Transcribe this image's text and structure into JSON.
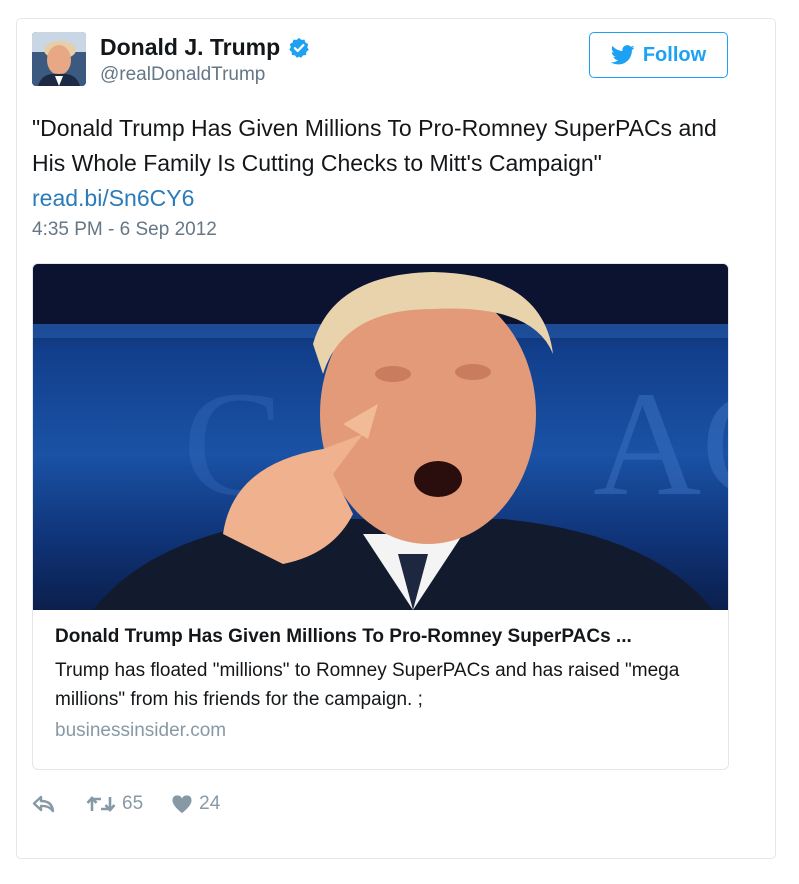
{
  "author": {
    "name": "Donald J. Trump",
    "handle": "@realDonaldTrump",
    "verified_icon": "verified-badge-icon",
    "avatar": "profile-photo"
  },
  "follow_button": {
    "label": "Follow",
    "icon": "twitter-bird-icon",
    "color": "#1da1f2"
  },
  "tweet": {
    "text": "\"Donald Trump Has Given Millions To Pro-Romney SuperPACs and His Whole Family Is Cutting Checks to Mitt's Campaign\"",
    "link": "read.bi/Sn6CY6",
    "timestamp": "4:35 PM - 6 Sep 2012"
  },
  "card": {
    "image": "photo-man-pointing",
    "title": "Donald Trump Has Given Millions To Pro-Romney SuperPACs ...",
    "description": "Trump has floated \"millions\" to Romney SuperPACs and has raised \"mega millions\" from his friends for the campaign. ;",
    "domain": "businessinsider.com"
  },
  "actions": {
    "reply": {
      "icon": "reply-icon"
    },
    "retweet": {
      "icon": "retweet-icon",
      "count": "65"
    },
    "like": {
      "icon": "heart-icon",
      "count": "24"
    }
  },
  "colors": {
    "link": "#2b7bb9",
    "secondary_text": "#657786",
    "border": "#e1e8ed"
  }
}
